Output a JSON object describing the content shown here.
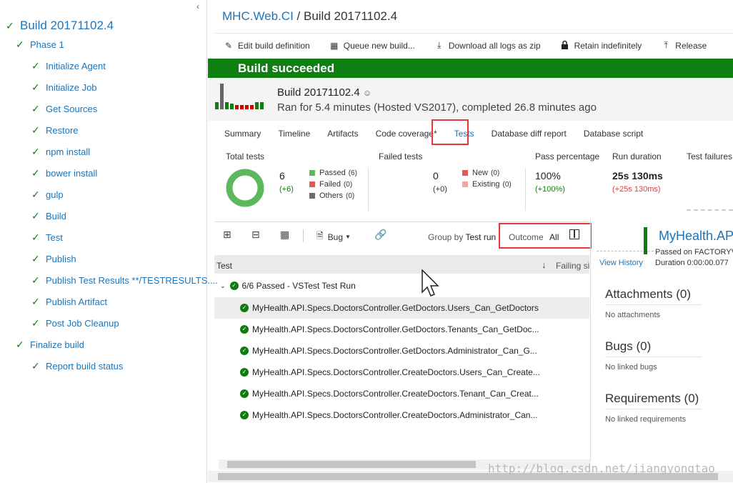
{
  "tree": {
    "root": "Build 20171102.4",
    "items": [
      {
        "label": "Phase 1",
        "level": 1
      },
      {
        "label": "Initialize Agent",
        "level": 2
      },
      {
        "label": "Initialize Job",
        "level": 2
      },
      {
        "label": "Get Sources",
        "level": 2
      },
      {
        "label": "Restore",
        "level": 2
      },
      {
        "label": "npm install",
        "level": 2
      },
      {
        "label": "bower install",
        "level": 2
      },
      {
        "label": "gulp",
        "level": 2
      },
      {
        "label": "Build",
        "level": 2
      },
      {
        "label": "Test",
        "level": 2
      },
      {
        "label": "Publish",
        "level": 2
      },
      {
        "label": "Publish Test Results **/TESTRESULTS....",
        "level": 2
      },
      {
        "label": "Publish Artifact",
        "level": 2
      },
      {
        "label": "Post Job Cleanup",
        "level": 2
      },
      {
        "label": "Finalize build",
        "level": 1
      },
      {
        "label": "Report build status",
        "level": 2
      }
    ]
  },
  "header": {
    "project": "MHC.Web.CI",
    "separator": " / ",
    "build": "Build 20171102.4"
  },
  "toolbar": {
    "edit": "Edit build definition",
    "queue": "Queue new build...",
    "download": "Download all logs as zip",
    "retain": "Retain indefinitely",
    "release": "Release"
  },
  "banner": "Build succeeded",
  "summary": {
    "title": "Build 20171102.4",
    "subtitle": "Ran for 5.4 minutes (Hosted VS2017), completed 26.8 minutes ago"
  },
  "tabs": [
    "Summary",
    "Timeline",
    "Artifacts",
    "Code coverage*",
    "Tests",
    "Database diff report",
    "Database script"
  ],
  "stats": {
    "total_tests": {
      "label": "Total tests",
      "value": "6",
      "delta": "(+6)"
    },
    "legend": [
      {
        "label": "Passed",
        "count": "(6)",
        "color": "#5cb85c"
      },
      {
        "label": "Failed",
        "count": "(0)",
        "color": "#e05a5a"
      },
      {
        "label": "Others",
        "count": "(0)",
        "color": "#6d6d6d"
      }
    ],
    "failed_tests": {
      "label": "Failed tests",
      "value": "0",
      "delta": "(+0)"
    },
    "failed_legend": [
      {
        "label": "New",
        "count": "(0)",
        "color": "#e05a5a"
      },
      {
        "label": "Existing",
        "count": "(0)",
        "color": "#f0a5a5"
      }
    ],
    "pass_percentage": {
      "label": "Pass percentage",
      "value": "100%",
      "delta": "(+100%)"
    },
    "run_duration": {
      "label": "Run duration",
      "value": "25s 130ms",
      "delta": "(+25s 130ms)"
    },
    "test_failures": {
      "label": "Test failures"
    }
  },
  "test_toolbar": {
    "bug": "Bug",
    "group_by_label": "Group by",
    "group_by_value": "Test run",
    "outcome_label": "Outcome",
    "outcome_value": "All"
  },
  "grid": {
    "col_test": "Test",
    "col_failing": "Failing si",
    "group": "6/6 Passed - VSTest Test Run",
    "rows": [
      "MyHealth.API.Specs.DoctorsController.GetDoctors.Users_Can_GetDoctors",
      "MyHealth.API.Specs.DoctorsController.GetDoctors.Tenants_Can_GetDoc...",
      "MyHealth.API.Specs.DoctorsController.GetDoctors.Administrator_Can_G...",
      "MyHealth.API.Specs.DoctorsController.CreateDoctors.Users_Can_Create...",
      "MyHealth.API.Specs.DoctorsController.CreateDoctors.Tenant_Can_Creat...",
      "MyHealth.API.Specs.DoctorsController.CreateDoctors.Administrator_Can..."
    ]
  },
  "detail": {
    "title": "MyHealth.API",
    "passed_on": "Passed on FACTORYV",
    "duration": "Duration 0:00:00.077",
    "view_history": "View History",
    "attachments": "Attachments (0)",
    "attachments_note": "No attachments",
    "bugs": "Bugs (0)",
    "bugs_note": "No linked bugs",
    "requirements": "Requirements (0)",
    "requirements_note": "No linked requirements"
  },
  "watermark": "http://blog.csdn.net/jiangyongtao",
  "colors": {
    "accent": "#1d74b8",
    "success": "#0f7f12",
    "highlight": "#e53935"
  }
}
